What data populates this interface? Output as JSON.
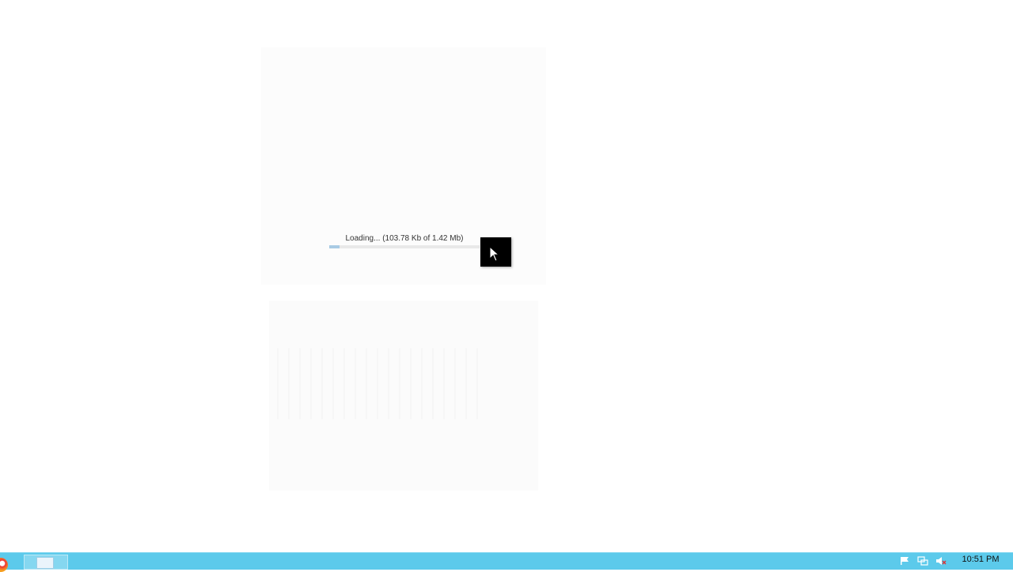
{
  "loader": {
    "text": "Loading... (103.78 Kb of 1.42 Mb)",
    "progress_fraction": 0.07
  },
  "taskbar": {
    "clock": "10:51 PM",
    "start_icon": "start-orb-icon",
    "pinned_app_icon": "file-explorer-icon",
    "tray_icons": [
      "action-center-flag-icon",
      "network-icon",
      "speaker-icon"
    ]
  },
  "colors": {
    "taskbar": "#5ccaeb",
    "progress_fill": "#a9cbe4",
    "background": "#ffffff"
  }
}
